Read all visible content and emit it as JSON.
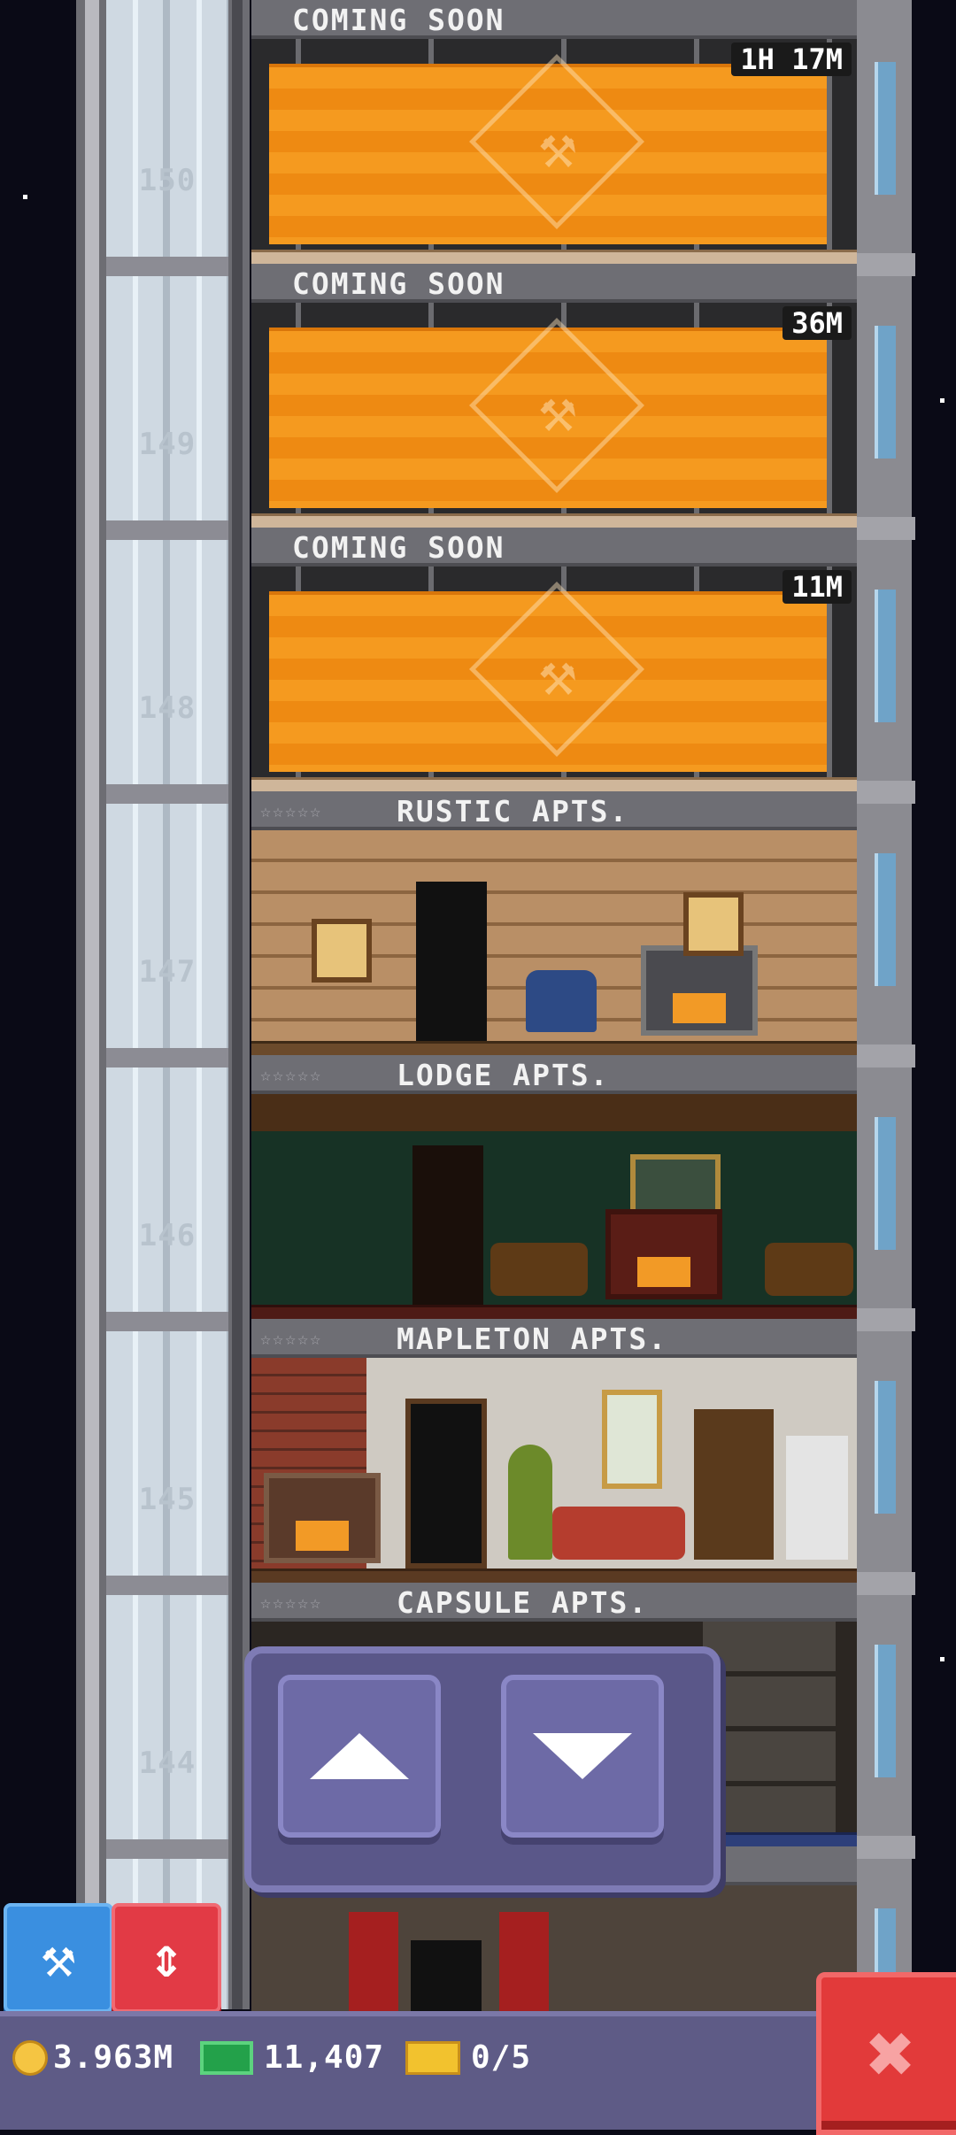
{
  "floors": [
    {
      "number": "150",
      "name": "COMING SOON",
      "status": "construction",
      "timer": "1H 17M"
    },
    {
      "number": "149",
      "name": "COMING SOON",
      "status": "construction",
      "timer": "36M"
    },
    {
      "number": "148",
      "name": "COMING SOON",
      "status": "construction",
      "timer": "11M"
    },
    {
      "number": "147",
      "name": "RUSTIC APTS.",
      "status": "built",
      "rating": "☆☆☆☆☆"
    },
    {
      "number": "146",
      "name": "LODGE APTS.",
      "status": "built",
      "rating": "☆☆☆☆☆"
    },
    {
      "number": "145",
      "name": "MAPLETON APTS.",
      "status": "built",
      "rating": "☆☆☆☆☆"
    },
    {
      "number": "144",
      "name": "CAPSULE APTS.",
      "status": "built",
      "rating": "☆☆☆☆☆"
    }
  ],
  "elevator": {
    "up_icon": "arrow-up-icon",
    "down_icon": "arrow-down-icon"
  },
  "tools": {
    "build_icon": "hammer-icon",
    "build_glyph": "⚒",
    "elevator_icon": "up-down-arrows-icon",
    "elevator_glyph": "⇕"
  },
  "stats": {
    "coins": "3.963M",
    "tower_bux": "11,407",
    "tickets": "0/5"
  },
  "close": {
    "icon": "close-icon",
    "glyph": "✖"
  },
  "colors": {
    "tarp": "#f59a1f",
    "panel": "#5a5789",
    "close": "#e23a3a",
    "bottom_bar": "#5e5b86"
  }
}
